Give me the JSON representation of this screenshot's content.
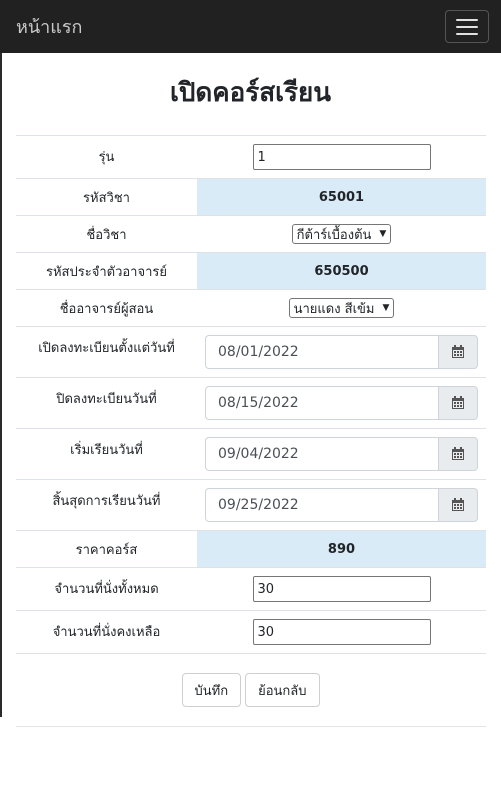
{
  "navbar": {
    "brand": "หน้าแรก",
    "menu_icon": "hamburger-icon"
  },
  "page_title": "เปิดคอร์สเรียน",
  "form": {
    "batch_label": "รุ่น",
    "batch_value": "1",
    "course_code_label": "รหัสวิชา",
    "course_code_value": "65001",
    "course_name_label": "ชื่อวิชา",
    "course_name_value": "กีต้าร์เบื้องต้น",
    "teacher_id_label": "รหัสประจำตัวอาจารย์",
    "teacher_id_value": "650500",
    "teacher_name_label": "ชื่ออาจารย์ผู้สอน",
    "teacher_name_value": "นายแดง สีเข้ม",
    "reg_open_label": "เปิดลงทะเบียนตั้งแต่วันที่",
    "reg_open_value": "08/01/2022",
    "reg_close_label": "ปิดลงทะเบียนวันที่",
    "reg_close_value": "08/15/2022",
    "start_label": "เริ่มเรียนวันที่",
    "start_value": "09/04/2022",
    "end_label": "สิ้นสุดการเรียนวันที่",
    "end_value": "09/25/2022",
    "price_label": "ราคาคอร์ส",
    "price_value": "890",
    "total_seats_label": "จำนวนที่นั่งทั้งหมด",
    "total_seats_value": "30",
    "remaining_seats_label": "จำนวนที่นั่งคงเหลือ",
    "remaining_seats_value": "30"
  },
  "buttons": {
    "save": "บันทึก",
    "back": "ย้อนกลับ"
  }
}
